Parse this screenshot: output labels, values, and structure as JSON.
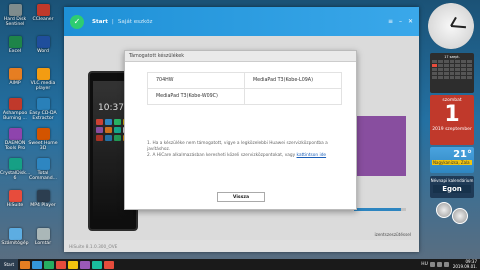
{
  "desktop_icons": [
    {
      "label": "Hard Disk Sentinel",
      "color": "#7f8c8d"
    },
    {
      "label": "CCleaner",
      "color": "#c0392b"
    },
    {
      "label": "Excel",
      "color": "#1e8449"
    },
    {
      "label": "Word",
      "color": "#1f4e9c"
    },
    {
      "label": "AIMP",
      "color": "#e67e22"
    },
    {
      "label": "VLC media player",
      "color": "#f39c12"
    },
    {
      "label": "Ashampoo Burning ...",
      "color": "#c0392b"
    },
    {
      "label": "Easy CD-DA Extractor",
      "color": "#2980b9"
    },
    {
      "label": "DAEMON Tools Pro",
      "color": "#8e44ad"
    },
    {
      "label": "Sweet Home 3D",
      "color": "#d35400"
    },
    {
      "label": "CrystalDisk... 6",
      "color": "#16a085"
    },
    {
      "label": "Total Command...",
      "color": "#2e86c1"
    },
    {
      "label": "HiSuite",
      "color": "#e74c3c"
    },
    {
      "label": "MP4 Player",
      "color": "#2c3e50"
    },
    {
      "label": "Számítógép",
      "color": "#5dade2"
    },
    {
      "label": "Lomtár",
      "color": "#aab7b8"
    }
  ],
  "hisuite": {
    "tab_start": "Start",
    "separator": "|",
    "tab_own_device": "Saját eszköz",
    "version": "HiSuite 8.1.0.300_OVE",
    "side_text": "izentszeszütéssel",
    "phone_time": "10:37",
    "progress_fraction": 0.9
  },
  "dialog": {
    "title": "Támogatott készülékek",
    "rows": [
      [
        "704HW",
        "MediaPad T3(Kobe-L09A)"
      ],
      [
        "MediaPad T3(Kobe-W09C)",
        ""
      ]
    ],
    "note1": "1. Ha a készüléke nem támogatott, vigye a legközelebbi Huawei szervizközpontba a javításhoz.",
    "note2_prefix": "2. A HiCare alkalmazásban keresheti közeli szervizközpontokat, vagy ",
    "note2_link": "kattintson ide",
    "back_button": "Vissza"
  },
  "gadgets": {
    "calendar_header": "17 szept.",
    "day_name": "szombat",
    "day_number": "1",
    "month_year": "2019 szeptember",
    "temperature": "21°",
    "city": "Nagykanizsa, Zala",
    "nameday_label": "Névnapi kalendárium",
    "nameday_name": "Egon"
  },
  "taskbar": {
    "start_label": "Start",
    "tray_lang": "HU",
    "tray_time": "09:37",
    "tray_date": "2019.09.01."
  }
}
